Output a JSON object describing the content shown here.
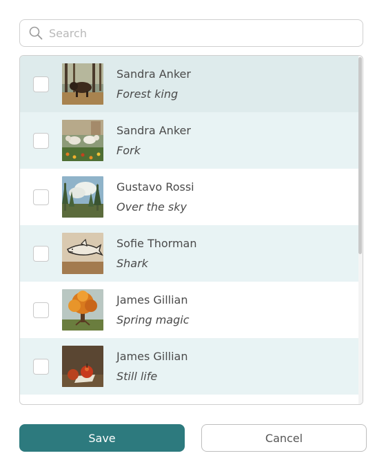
{
  "search": {
    "placeholder": "Search",
    "icon": "search-icon"
  },
  "items": [
    {
      "artist": "Sandra Anker",
      "title": "Forest king",
      "checked": false,
      "thumbnail": "bison-in-forest"
    },
    {
      "artist": "Sandra Anker",
      "title": "Fork",
      "checked": false,
      "thumbnail": "goats-in-flowers"
    },
    {
      "artist": "Gustavo Rossi",
      "title": "Over the sky",
      "checked": false,
      "thumbnail": "forest-sky"
    },
    {
      "artist": "Sofie Thorman",
      "title": "Shark",
      "checked": false,
      "thumbnail": "shark-sketch"
    },
    {
      "artist": "James Gillian",
      "title": "Spring magic",
      "checked": false,
      "thumbnail": "orange-tree"
    },
    {
      "artist": "James Gillian",
      "title": "Still life",
      "checked": false,
      "thumbnail": "apples"
    }
  ],
  "actions": {
    "save_label": "Save",
    "cancel_label": "Cancel"
  },
  "colors": {
    "accent": "#2d7a7e",
    "row_tint": "#e8f3f4",
    "row_selected": "#deebec"
  }
}
